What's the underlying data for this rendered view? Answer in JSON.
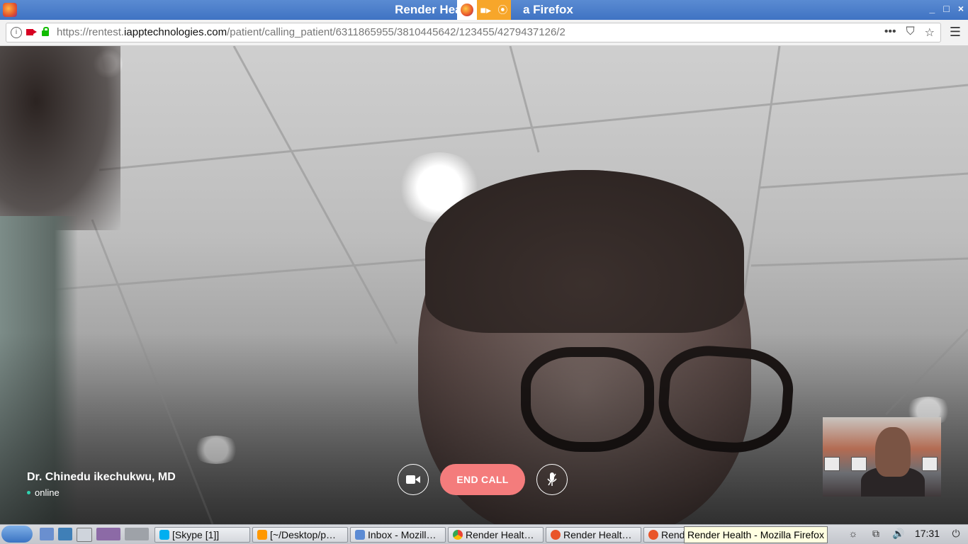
{
  "window": {
    "title": "Render Health - Mozilla Firefox",
    "title_left": "Render Healt",
    "title_right": "a Firefox",
    "controls": [
      "_",
      "□",
      "×"
    ]
  },
  "browser": {
    "url_prefix": "https://rentest.",
    "url_host": "iapptechnologies.com",
    "url_path": "/patient/calling_patient/6311865955/3810445642/123455/4279437126/2",
    "more_label": "•••",
    "pocket_icon": "pocket-icon",
    "bookmark_star": "☆",
    "menu": "☰"
  },
  "call": {
    "caller_name": "Dr. Chinedu ikechukwu, MD",
    "status": "online",
    "end_call_label": "END CALL",
    "camera_icon": "video-camera-icon",
    "mic_icon": "microphone-icon"
  },
  "taskbar": {
    "items": [
      {
        "label": "[Skype [1]]",
        "color": "#00aff0"
      },
      {
        "label": "[~/Desktop/p…",
        "color": "#ff9800"
      },
      {
        "label": "Inbox - Mozill…",
        "color": "#5b8bd4"
      },
      {
        "label": "Render Healt…",
        "color": "#34a853"
      },
      {
        "label": "Render Healt…",
        "color": "#e9552a"
      },
      {
        "label": "Rend",
        "color": "#e9552a"
      }
    ],
    "tooltip": "Render Health - Mozilla Firefox",
    "clock": "17:31",
    "volume_icon": "🔊",
    "power_icon": "⏻"
  },
  "colors": {
    "end_call": "#f47c7c",
    "status_dot": "#2fd3b0",
    "recording_indicator": "#f7a62a",
    "titlebar": "#4a7ecb"
  }
}
